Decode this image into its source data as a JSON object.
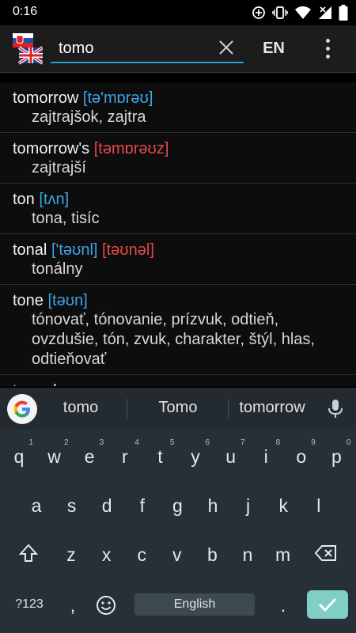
{
  "status": {
    "time": "0:16"
  },
  "search": {
    "value": "tomo"
  },
  "toolbar": {
    "lang_label": "EN"
  },
  "results": [
    {
      "word": "tomorrow",
      "pron_uk": "[tə'mɒrəʊ]",
      "pron_us": "",
      "translation": "zajtrajšok, zajtra"
    },
    {
      "word": "tomorrow's",
      "pron_uk": "",
      "pron_us": "[təmɒrəʊz]",
      "translation": "zajtrajší"
    },
    {
      "word": "ton",
      "pron_uk": "[tʌn]",
      "pron_us": "",
      "translation": "tona, tisíc"
    },
    {
      "word": "tonal",
      "pron_uk": "['təʊnl]",
      "pron_us": "[təʊnəl]",
      "translation": "tonálny"
    },
    {
      "word": "tone",
      "pron_uk": "[təʊn]",
      "pron_us": "",
      "translation": "tónovať, tónovanie, prízvuk, odtieň, ovzdušie, tón, zvuk, charakter, štýl, hlas, odtieňovať"
    },
    {
      "word": "tone down",
      "pron_uk": "",
      "pron_us": "",
      "translation": ""
    }
  ],
  "suggestions": [
    "tomo",
    "Tomo",
    "tomorrow"
  ],
  "keyboard": {
    "row1": [
      {
        "k": "q",
        "h": "1"
      },
      {
        "k": "w",
        "h": "2"
      },
      {
        "k": "e",
        "h": "3"
      },
      {
        "k": "r",
        "h": "4"
      },
      {
        "k": "t",
        "h": "5"
      },
      {
        "k": "y",
        "h": "6"
      },
      {
        "k": "u",
        "h": "7"
      },
      {
        "k": "i",
        "h": "8"
      },
      {
        "k": "o",
        "h": "9"
      },
      {
        "k": "p",
        "h": "0"
      }
    ],
    "row2": [
      "a",
      "s",
      "d",
      "f",
      "g",
      "h",
      "j",
      "k",
      "l"
    ],
    "row3": [
      "z",
      "x",
      "c",
      "v",
      "b",
      "n",
      "m"
    ],
    "symbols_label": "?123",
    "comma": ",",
    "period": ".",
    "space_label": "English"
  },
  "colors": {
    "accent": "#2a9fd8",
    "pron_uk": "#3da5e6",
    "pron_us": "#e84848",
    "enter_key": "#7fcfc6",
    "keyboard_bg": "#263036"
  }
}
